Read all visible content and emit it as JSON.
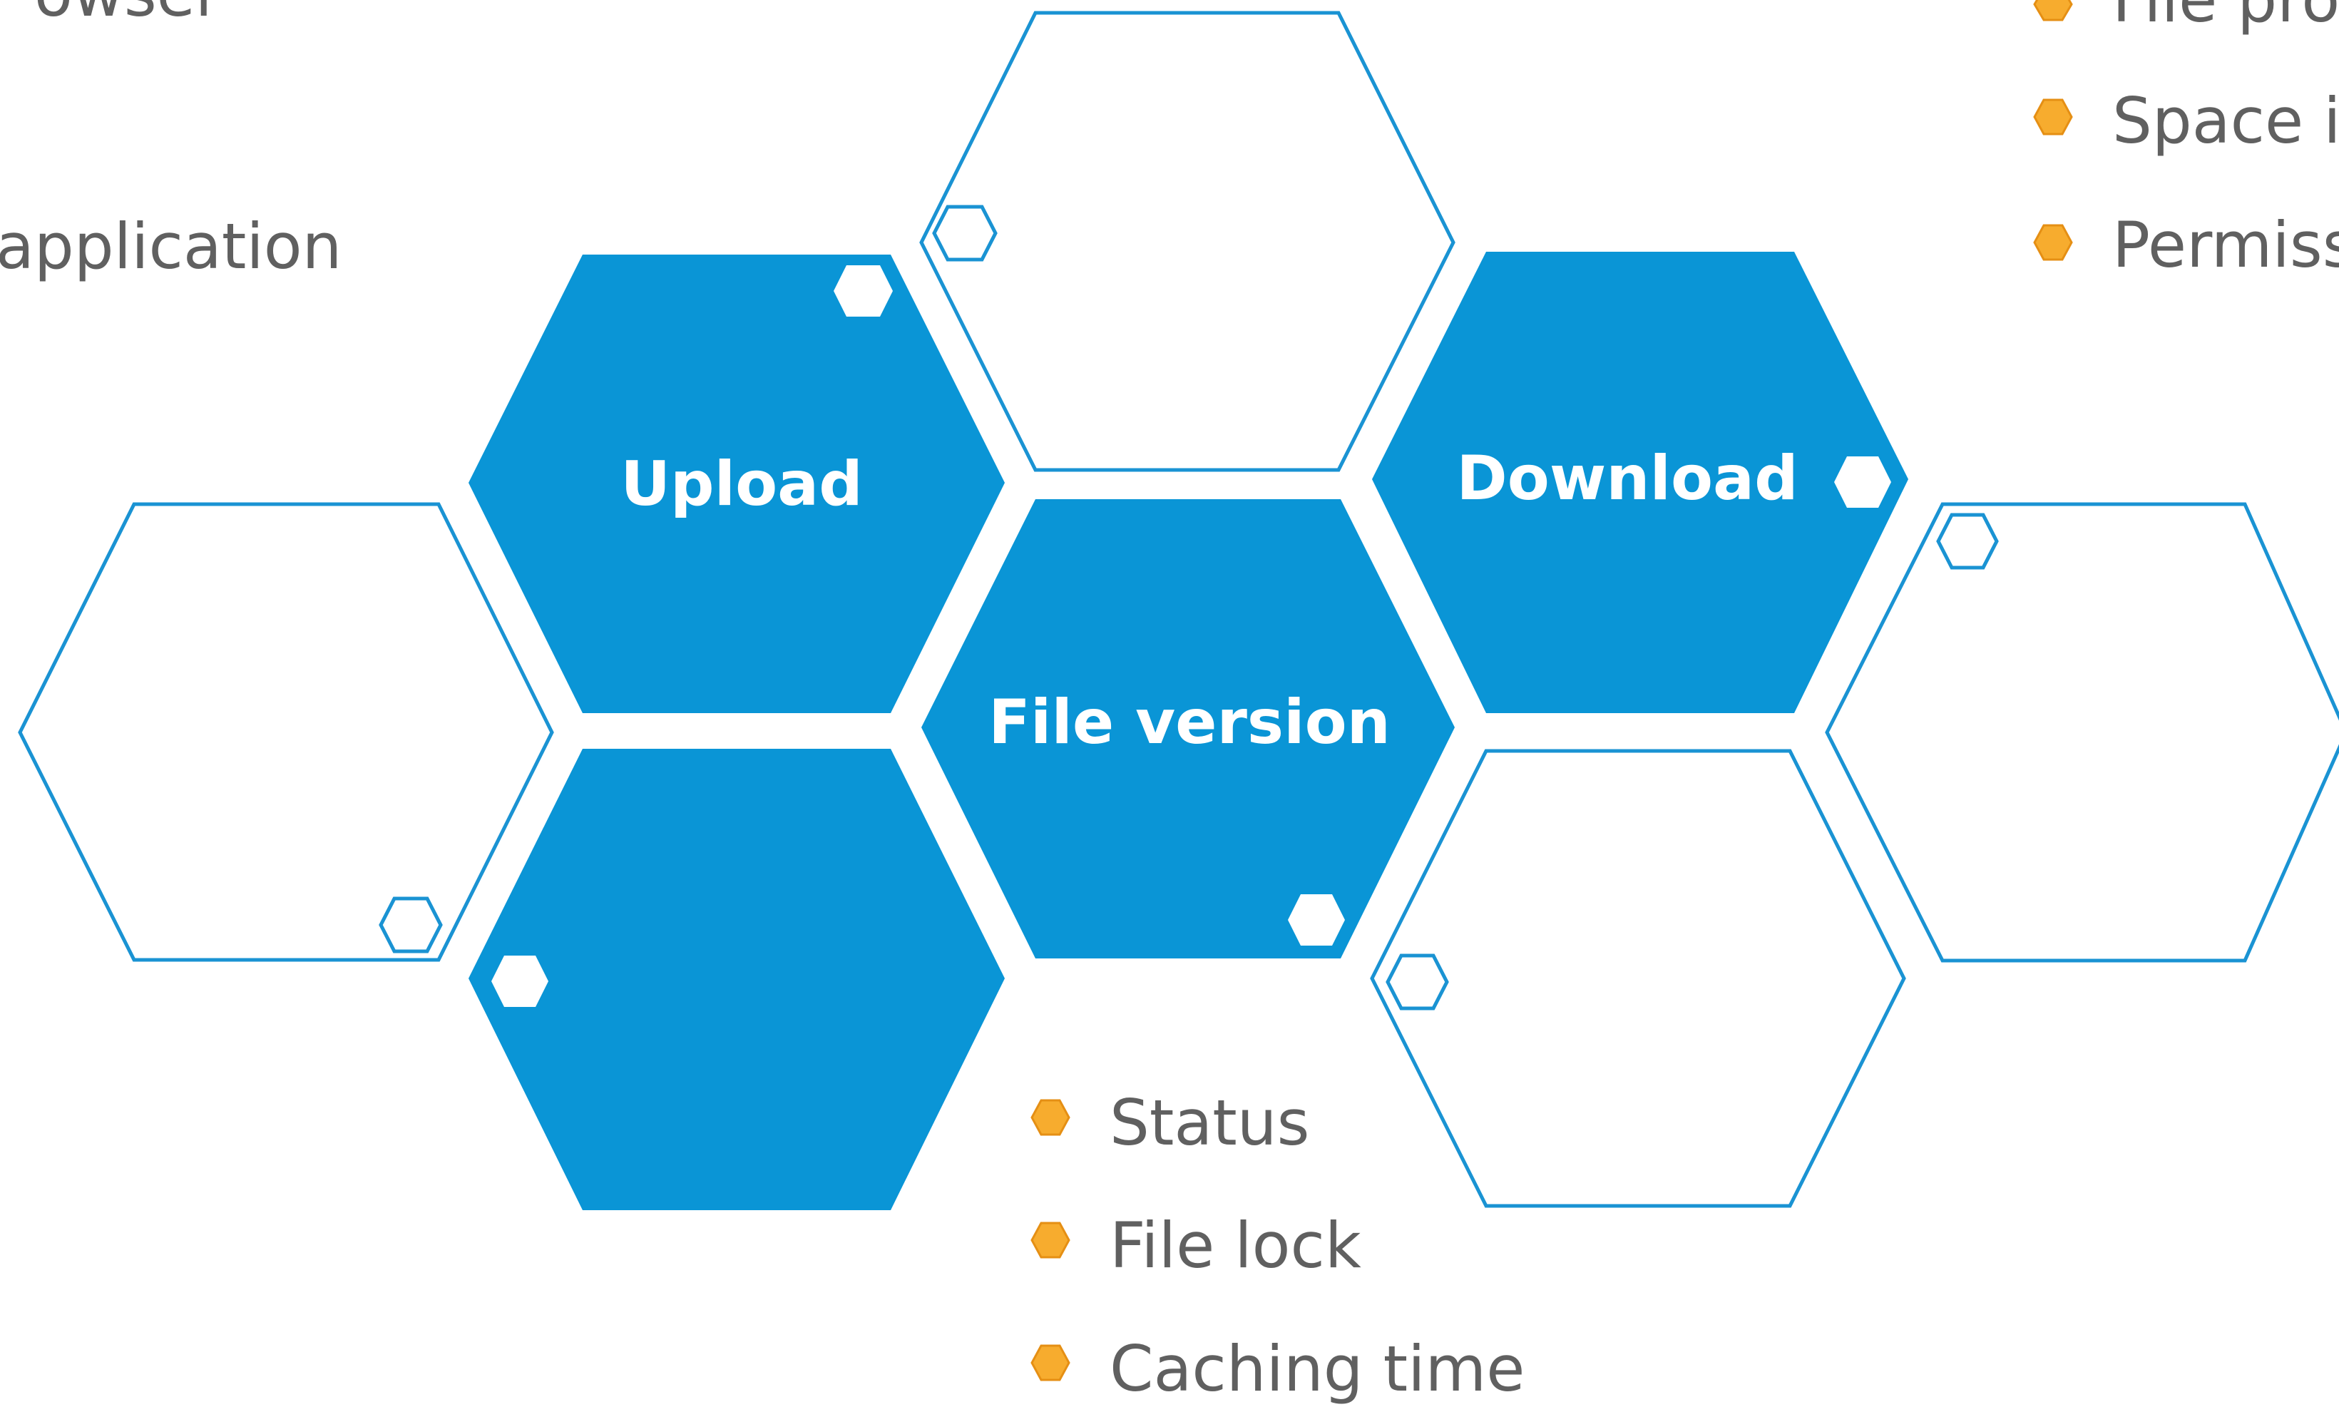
{
  "colors": {
    "hex_fill": "#0a95d6",
    "hex_stroke": "#1a93d3",
    "bullet_fill": "#f7ac2e",
    "bullet_stroke": "#e58f14",
    "text": "#606060",
    "background": "#ffffff"
  },
  "hexagons": {
    "upload": "Upload",
    "download": "Download",
    "file_version": "File version"
  },
  "left_list": {
    "browser_fragment": "owser",
    "application_fragment": "application"
  },
  "right_list": {
    "item1_fragment": "File pro",
    "item2_fragment": "Space i",
    "item3_fragment": "Permiss"
  },
  "bottom_list": {
    "items": [
      "Status",
      "File lock",
      "Caching time"
    ]
  }
}
